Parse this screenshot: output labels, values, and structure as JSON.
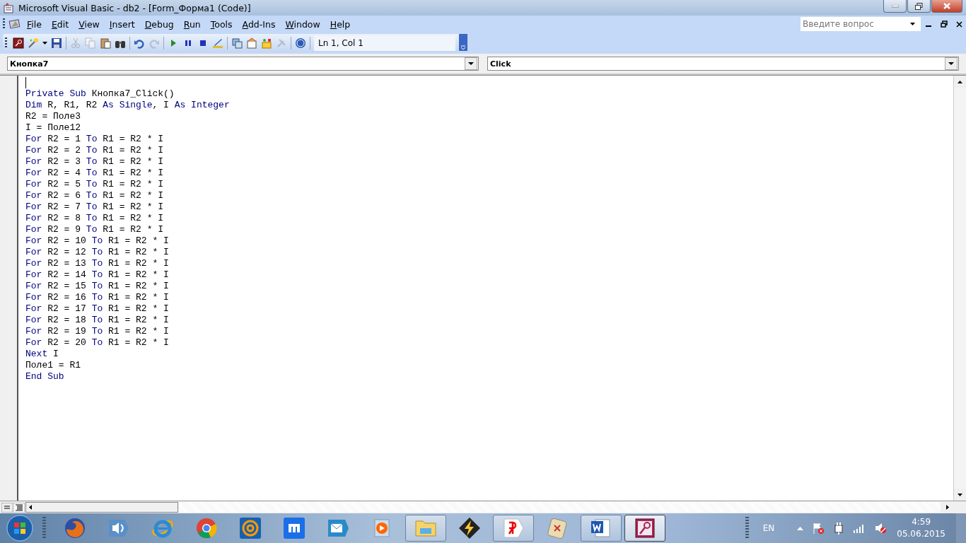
{
  "window": {
    "title": "Microsoft Visual Basic - db2 - [Form_Форма1 (Code)]"
  },
  "menu": [
    {
      "label": "File"
    },
    {
      "label": "Edit"
    },
    {
      "label": "View"
    },
    {
      "label": "Insert"
    },
    {
      "label": "Debug"
    },
    {
      "label": "Run"
    },
    {
      "label": "Tools"
    },
    {
      "label": "Add-Ins"
    },
    {
      "label": "Window"
    },
    {
      "label": "Help"
    }
  ],
  "help_search": {
    "placeholder": "Введите вопрос"
  },
  "toolbar": {
    "position": "Ln 1, Col 1"
  },
  "object_dropdown": {
    "value": "Кнопка7"
  },
  "procedure_dropdown": {
    "value": "Click"
  },
  "code_lines": [
    [
      {
        "kind": "keyword",
        "text": "Private Sub"
      },
      {
        "kind": "plain",
        "text": " Кнопка7_Click()"
      }
    ],
    [
      {
        "kind": "keyword",
        "text": "Dim"
      },
      {
        "kind": "plain",
        "text": " R, R1, R2 "
      },
      {
        "kind": "keyword",
        "text": "As Single"
      },
      {
        "kind": "plain",
        "text": ", I "
      },
      {
        "kind": "keyword",
        "text": "As Integer"
      }
    ],
    [
      {
        "kind": "plain",
        "text": "R2 = Поле3"
      }
    ],
    [
      {
        "kind": "plain",
        "text": "I = Поле12"
      }
    ],
    [
      {
        "kind": "keyword",
        "text": "For"
      },
      {
        "kind": "plain",
        "text": " R2 = 1 "
      },
      {
        "kind": "keyword",
        "text": "To"
      },
      {
        "kind": "plain",
        "text": " R1 = R2 * I"
      }
    ],
    [
      {
        "kind": "keyword",
        "text": "For"
      },
      {
        "kind": "plain",
        "text": " R2 = 2 "
      },
      {
        "kind": "keyword",
        "text": "To"
      },
      {
        "kind": "plain",
        "text": " R1 = R2 * I"
      }
    ],
    [
      {
        "kind": "keyword",
        "text": "For"
      },
      {
        "kind": "plain",
        "text": " R2 = 3 "
      },
      {
        "kind": "keyword",
        "text": "To"
      },
      {
        "kind": "plain",
        "text": " R1 = R2 * I"
      }
    ],
    [
      {
        "kind": "keyword",
        "text": "For"
      },
      {
        "kind": "plain",
        "text": " R2 = 4 "
      },
      {
        "kind": "keyword",
        "text": "To"
      },
      {
        "kind": "plain",
        "text": " R1 = R2 * I"
      }
    ],
    [
      {
        "kind": "keyword",
        "text": "For"
      },
      {
        "kind": "plain",
        "text": " R2 = 5 "
      },
      {
        "kind": "keyword",
        "text": "To"
      },
      {
        "kind": "plain",
        "text": " R1 = R2 * I"
      }
    ],
    [
      {
        "kind": "keyword",
        "text": "For"
      },
      {
        "kind": "plain",
        "text": " R2 = 6 "
      },
      {
        "kind": "keyword",
        "text": "To"
      },
      {
        "kind": "plain",
        "text": " R1 = R2 * I"
      }
    ],
    [
      {
        "kind": "keyword",
        "text": "For"
      },
      {
        "kind": "plain",
        "text": " R2 = 7 "
      },
      {
        "kind": "keyword",
        "text": "To"
      },
      {
        "kind": "plain",
        "text": " R1 = R2 * I"
      }
    ],
    [
      {
        "kind": "keyword",
        "text": "For"
      },
      {
        "kind": "plain",
        "text": " R2 = 8 "
      },
      {
        "kind": "keyword",
        "text": "To"
      },
      {
        "kind": "plain",
        "text": " R1 = R2 * I"
      }
    ],
    [
      {
        "kind": "keyword",
        "text": "For"
      },
      {
        "kind": "plain",
        "text": " R2 = 9 "
      },
      {
        "kind": "keyword",
        "text": "To"
      },
      {
        "kind": "plain",
        "text": " R1 = R2 * I"
      }
    ],
    [
      {
        "kind": "keyword",
        "text": "For"
      },
      {
        "kind": "plain",
        "text": " R2 = 10 "
      },
      {
        "kind": "keyword",
        "text": "To"
      },
      {
        "kind": "plain",
        "text": " R1 = R2 * I"
      }
    ],
    [
      {
        "kind": "keyword",
        "text": "For"
      },
      {
        "kind": "plain",
        "text": " R2 = 12 "
      },
      {
        "kind": "keyword",
        "text": "To"
      },
      {
        "kind": "plain",
        "text": " R1 = R2 * I"
      }
    ],
    [
      {
        "kind": "keyword",
        "text": "For"
      },
      {
        "kind": "plain",
        "text": " R2 = 13 "
      },
      {
        "kind": "keyword",
        "text": "To"
      },
      {
        "kind": "plain",
        "text": " R1 = R2 * I"
      }
    ],
    [
      {
        "kind": "keyword",
        "text": "For"
      },
      {
        "kind": "plain",
        "text": " R2 = 14 "
      },
      {
        "kind": "keyword",
        "text": "To"
      },
      {
        "kind": "plain",
        "text": " R1 = R2 * I"
      }
    ],
    [
      {
        "kind": "keyword",
        "text": "For"
      },
      {
        "kind": "plain",
        "text": " R2 = 15 "
      },
      {
        "kind": "keyword",
        "text": "To"
      },
      {
        "kind": "plain",
        "text": " R1 = R2 * I"
      }
    ],
    [
      {
        "kind": "keyword",
        "text": "For"
      },
      {
        "kind": "plain",
        "text": " R2 = 16 "
      },
      {
        "kind": "keyword",
        "text": "To"
      },
      {
        "kind": "plain",
        "text": " R1 = R2 * I"
      }
    ],
    [
      {
        "kind": "keyword",
        "text": "For"
      },
      {
        "kind": "plain",
        "text": " R2 = 17 "
      },
      {
        "kind": "keyword",
        "text": "To"
      },
      {
        "kind": "plain",
        "text": " R1 = R2 * I"
      }
    ],
    [
      {
        "kind": "keyword",
        "text": "For"
      },
      {
        "kind": "plain",
        "text": " R2 = 18 "
      },
      {
        "kind": "keyword",
        "text": "To"
      },
      {
        "kind": "plain",
        "text": " R1 = R2 * I"
      }
    ],
    [
      {
        "kind": "keyword",
        "text": "For"
      },
      {
        "kind": "plain",
        "text": " R2 = 19 "
      },
      {
        "kind": "keyword",
        "text": "To"
      },
      {
        "kind": "plain",
        "text": " R1 = R2 * I"
      }
    ],
    [
      {
        "kind": "keyword",
        "text": "For"
      },
      {
        "kind": "plain",
        "text": " R2 = 20 "
      },
      {
        "kind": "keyword",
        "text": "To"
      },
      {
        "kind": "plain",
        "text": " R1 = R2 * I"
      }
    ],
    [
      {
        "kind": "keyword",
        "text": "Next"
      },
      {
        "kind": "plain",
        "text": " I"
      }
    ],
    [
      {
        "kind": "plain",
        "text": "Поле1 = R1"
      }
    ],
    [
      {
        "kind": "keyword",
        "text": "End Sub"
      }
    ]
  ],
  "taskbar": {
    "apps": [
      {
        "kind": "firefox",
        "open": false,
        "selected": false
      },
      {
        "kind": "speaker",
        "open": false,
        "selected": false
      },
      {
        "kind": "ie",
        "open": false,
        "selected": false
      },
      {
        "kind": "chrome",
        "open": false,
        "selected": false
      },
      {
        "kind": "at",
        "open": false,
        "selected": false
      },
      {
        "kind": "maxthon",
        "open": false,
        "selected": false
      },
      {
        "kind": "envelope",
        "open": false,
        "selected": false
      },
      {
        "kind": "player",
        "open": false,
        "selected": false
      },
      {
        "kind": "folder",
        "open": true,
        "selected": false
      },
      {
        "kind": "bolt",
        "open": false,
        "selected": false
      },
      {
        "kind": "yandex",
        "open": true,
        "selected": false
      },
      {
        "kind": "mahjong",
        "open": false,
        "selected": false
      },
      {
        "kind": "word",
        "open": true,
        "selected": false
      },
      {
        "kind": "access",
        "open": true,
        "selected": true
      }
    ],
    "language": "EN",
    "time": "4:59",
    "date": "05.06.2015"
  }
}
